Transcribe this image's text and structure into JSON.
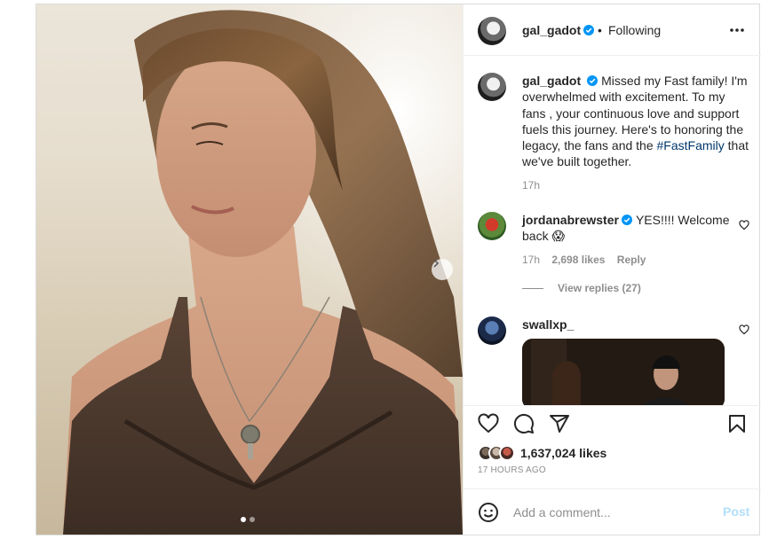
{
  "post": {
    "author": "gal_gadot",
    "header_separator": "•",
    "follow_status": "Following"
  },
  "caption": {
    "username": "gal_gadot",
    "text_before_tag": "Missed my Fast family! I'm overwhelmed with excitement. To my fans , your continuous love and support fuels this journey. Here's to honoring the legacy, the fans and the",
    "hashtag": "#FastFamily",
    "text_after_tag": "that we've built together.",
    "time": "17h"
  },
  "comments": [
    {
      "username": "jordanabrewster",
      "verified": true,
      "text": "YES!!!! Welcome back 😱",
      "time": "17h",
      "likes": "2,698 likes",
      "reply_label": "Reply",
      "view_replies": "View replies (27)"
    },
    {
      "username": "swallxp_",
      "verified": false,
      "attachment": "gif"
    }
  ],
  "engagement": {
    "likes_count": "1,637,024 likes",
    "time_ago": "17 HOURS AGO"
  },
  "composer": {
    "placeholder": "Add a comment...",
    "post_label": "Post"
  },
  "carousel": {
    "slide_count": 2,
    "active_slide": 1
  },
  "colors": {
    "verified_blue": "#0095f6",
    "hashtag": "#00376b",
    "post_disabled": "#b2dffc",
    "secondary_text": "#8e8e8e"
  },
  "icons": [
    "more-options-icon",
    "verified-icon",
    "heart-icon",
    "comment-icon",
    "share-icon",
    "bookmark-icon",
    "emoji-icon",
    "chevron-right-icon"
  ]
}
